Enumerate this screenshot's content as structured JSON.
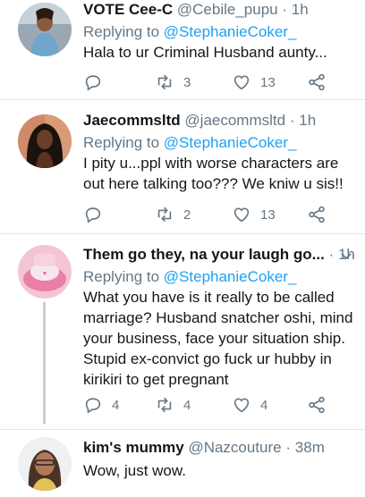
{
  "tweets": [
    {
      "name": "VOTE Cee-C",
      "handle": "@Cebile_pupu",
      "time": "1h",
      "reply_prefix": "Replying to",
      "reply_to": "@StephanieCoker_",
      "text": "Hala to ur Criminal Husband aunty...",
      "reply_count": "",
      "retweet_count": "3",
      "like_count": "13"
    },
    {
      "name": "Jaecommsltd",
      "handle": "@jaecommsltd",
      "time": "1h",
      "reply_prefix": "Replying to",
      "reply_to": "@StephanieCoker_",
      "text": "I pity u...ppl with worse characters are out here talking too??? We kniw u sis!!",
      "reply_count": "",
      "retweet_count": "2",
      "like_count": "13"
    },
    {
      "name": "Them go they, na your laugh go...",
      "handle": "",
      "time": "1h",
      "reply_prefix": "Replying to",
      "reply_to": "@StephanieCoker_",
      "text": "What you have is it really to be called marriage? Husband snatcher oshi, mind your business, face your situation ship. Stupid ex-convict go fuck ur hubby in kirikiri to get pregnant",
      "reply_count": "4",
      "retweet_count": "4",
      "like_count": "4"
    },
    {
      "name": "kim's mummy",
      "handle": "@Nazcouture",
      "time": "38m",
      "reply_prefix": "",
      "reply_to": "",
      "text": "Wow, just wow.",
      "reply_count": "",
      "retweet_count": "",
      "like_count": ""
    }
  ],
  "separator": "·",
  "icons": {
    "reply": "reply-icon",
    "retweet": "retweet-icon",
    "like": "heart-icon",
    "share": "share-icon",
    "menu": "chevron-down-icon"
  },
  "colors": {
    "link": "#1da1f2",
    "secondary_text": "#657786",
    "divider": "#e1e8ed"
  }
}
